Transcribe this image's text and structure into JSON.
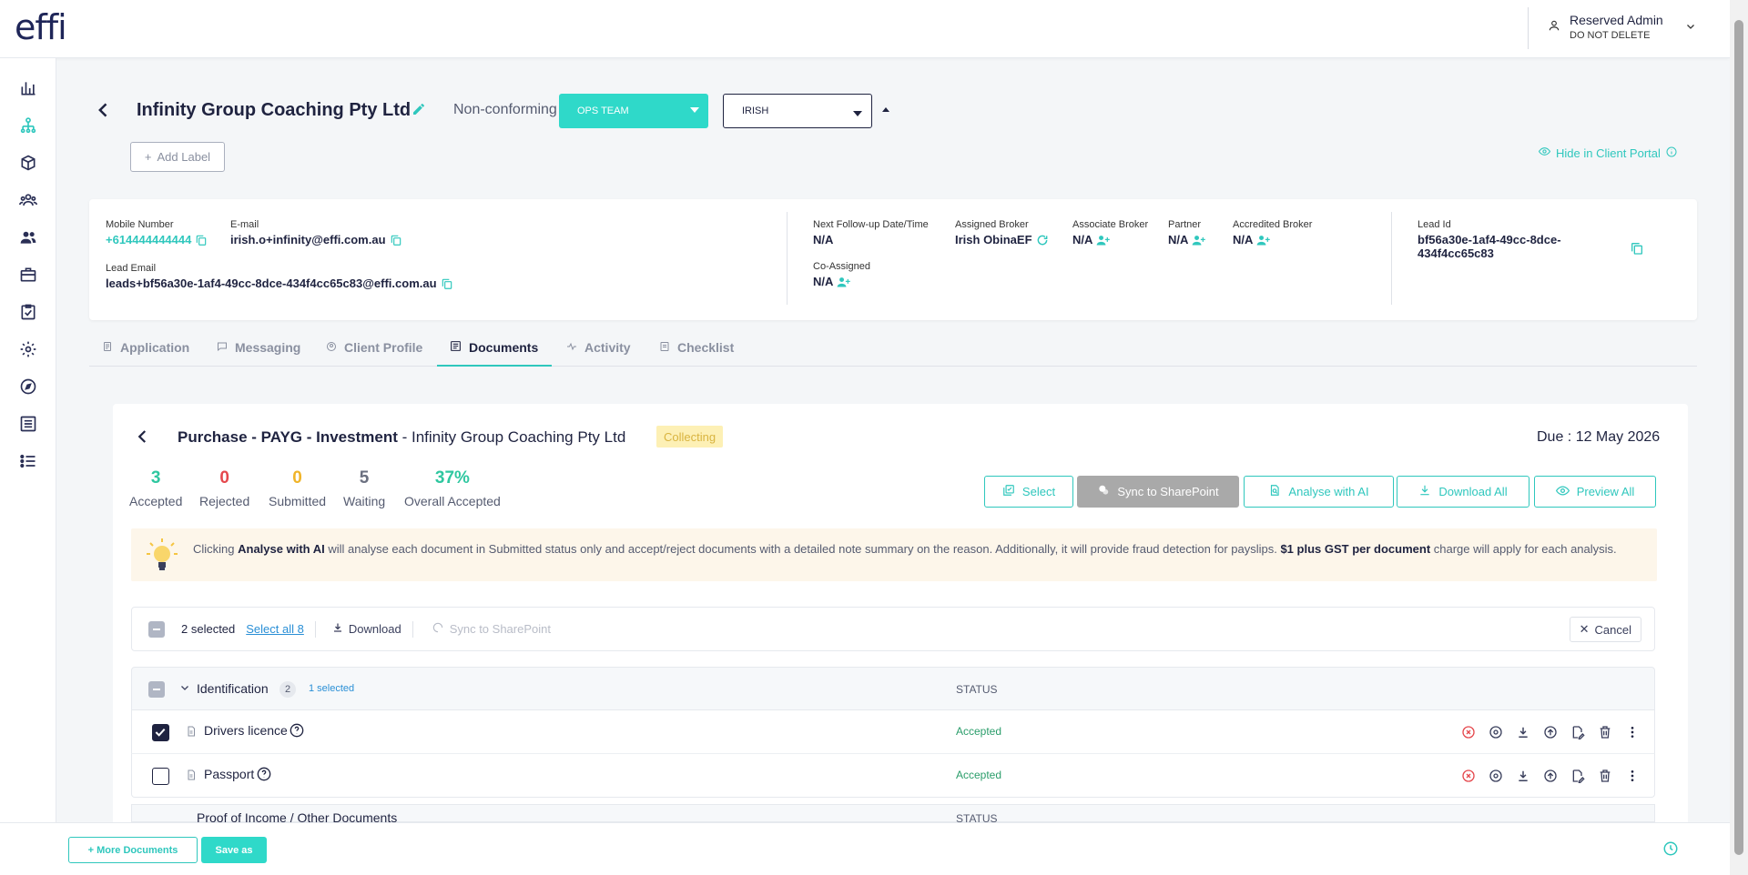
{
  "app": {
    "logo": "effi"
  },
  "user": {
    "name": "Reserved Admin",
    "subtitle": "DO NOT DELETE"
  },
  "sidebar": {
    "icons": [
      "dashboard-icon",
      "hierarchy-icon",
      "box-icon",
      "team-icon",
      "users-icon",
      "briefcase-icon",
      "clipboard-check-icon",
      "settings-icon",
      "compass-icon",
      "list-alt-icon",
      "list-icon"
    ]
  },
  "header": {
    "client_name": "Infinity Group Coaching Pty Ltd",
    "status": "Non-conforming",
    "team": "OPS TEAM",
    "assignee": "IRISH",
    "add_label": "Add Label",
    "hide_portal": "Hide in Client Portal"
  },
  "info": {
    "mobile_label": "Mobile Number",
    "mobile": "+614444444444",
    "email_label": "E-mail",
    "email": "irish.o+infinity@effi.com.au",
    "lead_email_label": "Lead Email",
    "lead_email": "leads+bf56a30e-1af4-49cc-8dce-434f4cc65c83@effi.com.au",
    "followup_label": "Next Follow-up Date/Time",
    "followup": "N/A",
    "coassigned_label": "Co-Assigned",
    "coassigned": "N/A",
    "broker_label": "Assigned Broker",
    "broker": "Irish ObinaEF",
    "assoc_label": "Associate Broker",
    "assoc": "N/A",
    "partner_label": "Partner",
    "partner": "N/A",
    "accredited_label": "Accredited Broker",
    "accredited": "N/A",
    "lead_id_label": "Lead Id",
    "lead_id_1": "bf56a30e-1af4-49cc-8dce-",
    "lead_id_2": "434f4cc65c83"
  },
  "tabs": [
    "Application",
    "Messaging",
    "Client Profile",
    "Documents",
    "Activity",
    "Checklist"
  ],
  "docs": {
    "title_bold": "Purchase - PAYG - Investment",
    "title_rest": " - Infinity Group Coaching Pty Ltd",
    "badge": "Collecting",
    "due": "Due : 12 May 2026",
    "stats": [
      {
        "num": "3",
        "label": "Accepted",
        "color": "#2fc7a0"
      },
      {
        "num": "0",
        "label": "Rejected",
        "color": "#e5484d"
      },
      {
        "num": "0",
        "label": "Submitted",
        "color": "#f0b429"
      },
      {
        "num": "5",
        "label": "Waiting",
        "color": "#6b7080"
      },
      {
        "num": "37%",
        "label": "Overall Accepted",
        "color": "#2fc7a0"
      }
    ],
    "buttons": {
      "select": "Select",
      "sync": "Sync to SharePoint",
      "analyse": "Analyse with AI",
      "download_all": "Download All",
      "preview_all": "Preview All"
    },
    "notice": {
      "p1": "Clicking ",
      "b1": "Analyse with AI",
      "p2": " will analyse each document in Submitted status only and accept/reject documents with a detailed note summary on the reason. Additionally, it will provide fraud detection for payslips. ",
      "b2": "$1 plus GST per document",
      "p3": " charge will apply for each analysis."
    },
    "selection": {
      "count": "2 selected",
      "select_all": "Select all 8",
      "download": "Download",
      "sync": "Sync to SharePoint",
      "cancel": "Cancel"
    },
    "group": {
      "name": "Identification",
      "count": "2",
      "selected": "1 selected",
      "status_header": "STATUS"
    },
    "rows": [
      {
        "name": "Drivers licence",
        "status": "Accepted",
        "checked": true
      },
      {
        "name": "Passport",
        "status": "Accepted",
        "checked": false
      }
    ],
    "group2": {
      "name": "Proof of Income / Other Documents",
      "status_header": "STATUS"
    }
  },
  "footer": {
    "more_docs": "+ More Documents",
    "save_as": "Save as"
  }
}
